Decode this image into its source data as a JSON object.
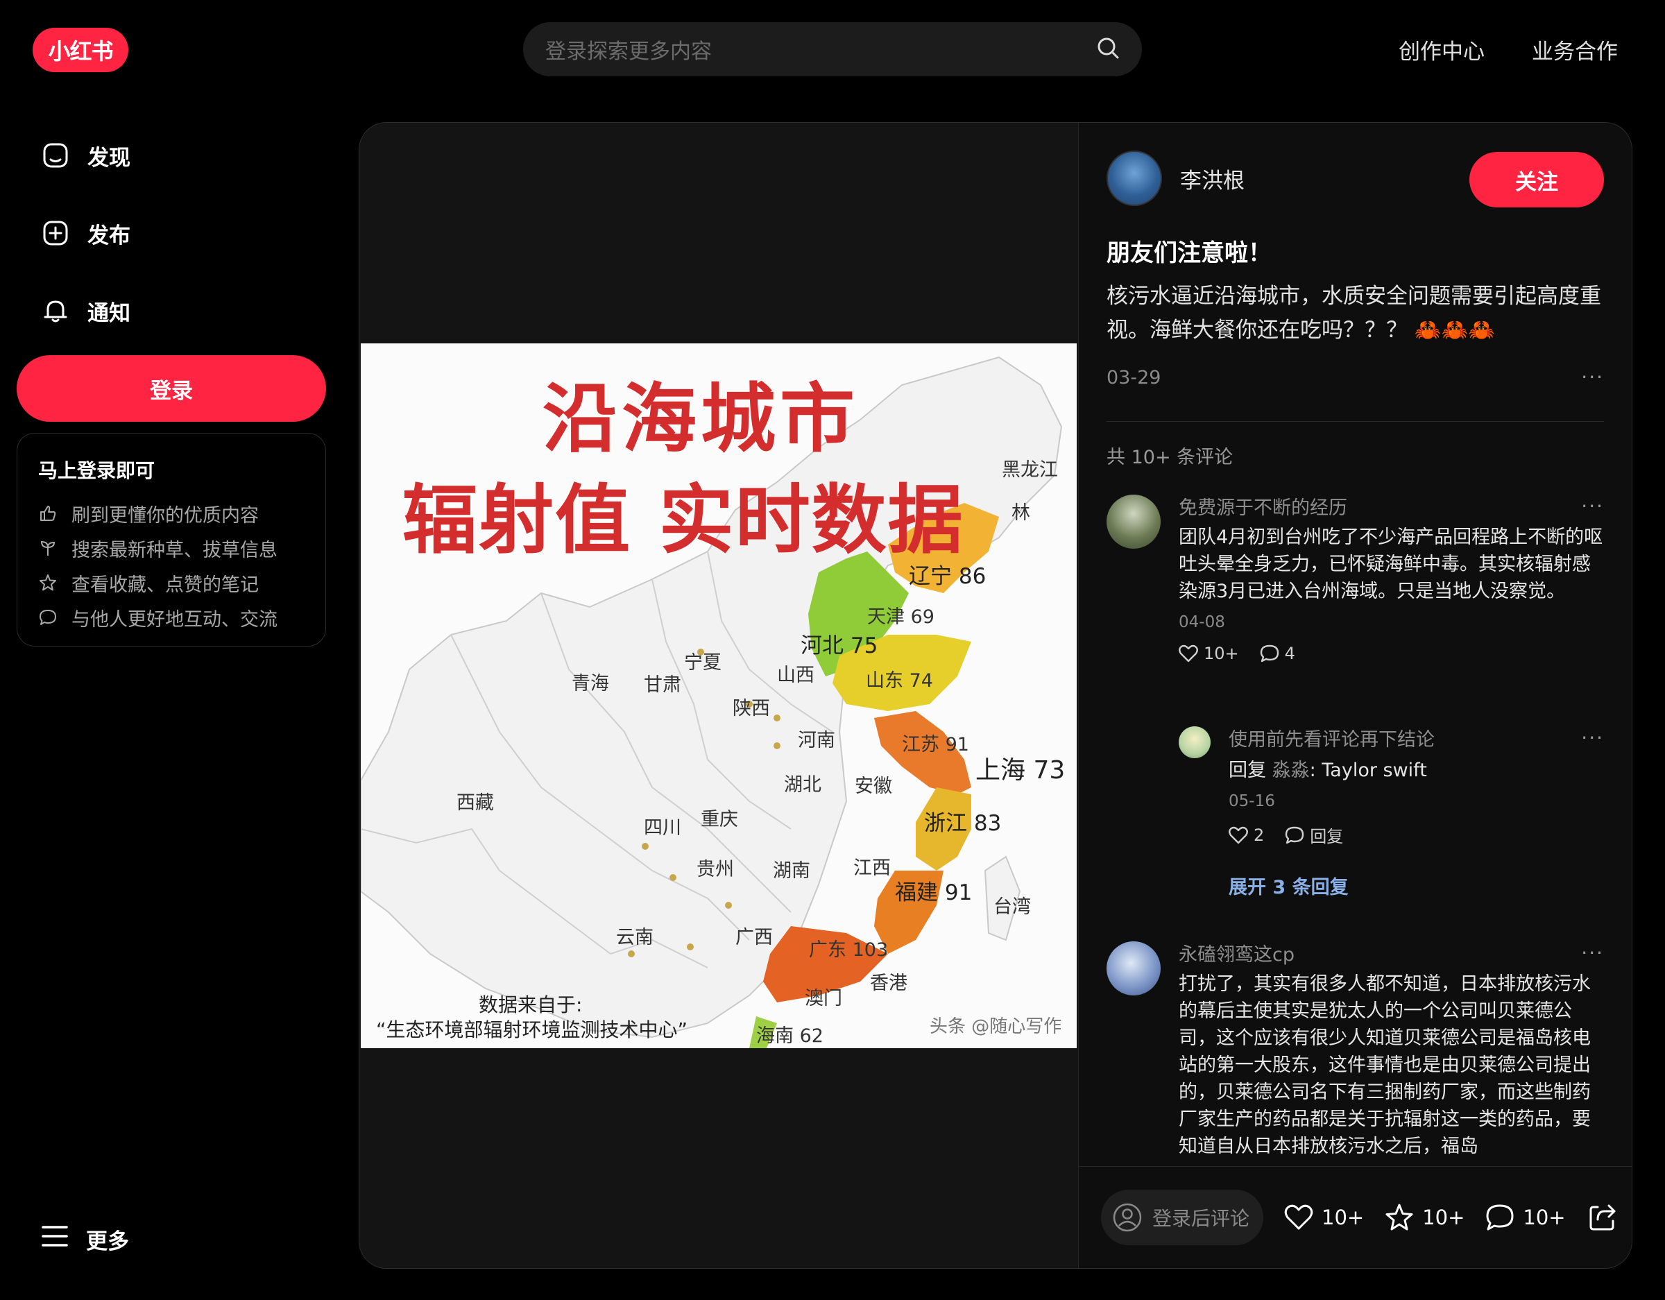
{
  "header": {
    "logo": "小红书",
    "search_placeholder": "登录探索更多内容",
    "nav": [
      "创作中心",
      "业务合作"
    ]
  },
  "sidebar": {
    "items": [
      {
        "label": "发现",
        "icon": "home-icon"
      },
      {
        "label": "发布",
        "icon": "plus-square-icon"
      },
      {
        "label": "通知",
        "icon": "bell-icon"
      }
    ],
    "login_label": "登录",
    "promo": {
      "title": "马上登录即可",
      "items": [
        {
          "label": "刷到更懂你的优质内容",
          "icon": "thumbs-up-icon"
        },
        {
          "label": "搜索最新种草、拔草信息",
          "icon": "sprout-icon"
        },
        {
          "label": "查看收藏、点赞的笔记",
          "icon": "star-icon"
        },
        {
          "label": "与他人更好地互动、交流",
          "icon": "chat-icon"
        }
      ]
    },
    "more_label": "更多"
  },
  "map": {
    "title_line1": "沿海城市",
    "title_line2": "辐射值 实时数据",
    "source_line1": "数据来自于:",
    "source_line2": "“生态环境部辐射环境监测技术中心”",
    "watermark": "头条 @随心写作",
    "labels": {
      "heilongjiang": "黑龙江",
      "jilin": "林",
      "liaoning": "辽宁 86",
      "tianjin": "天津 69",
      "hebei": "河北 75",
      "ningxia": "宁夏",
      "shanxi": "山西",
      "shandong": "山东 74",
      "qinghai": "青海",
      "gansu": "甘肃",
      "shaanxi": "陕西",
      "henan": "河南",
      "jiangsu": "江苏 91",
      "shanghai": "上海 73",
      "hubei": "湖北",
      "anhui": "安徽",
      "xizang": "西藏",
      "sichuan": "四川",
      "chongqing": "重庆",
      "zhejiang": "浙江 83",
      "guizhou": "贵州",
      "hunan": "湖南",
      "jiangxi": "江西",
      "fujian": "福建 91",
      "taiwan": "台湾",
      "yunnan": "云南",
      "guangxi": "广西",
      "guangdong": "广东 103",
      "hongkong": "香港",
      "macau": "澳门",
      "hainan": "海南 62"
    }
  },
  "note": {
    "author": "李洪根",
    "follow_label": "关注",
    "title": "朋友们注意啦！",
    "desc": "核污水逼近沿海城市，水质安全问题需要引起高度重视。海鲜大餐你还在吃吗？？？ 🦀🦀🦀",
    "date": "03-29",
    "comment_count": "共 10+ 条评论"
  },
  "comments": [
    {
      "name": "免费源于不断的经历",
      "text": "团队4月初到台州吃了不少海产品回程路上不断的呕吐头晕全身乏力，已怀疑海鲜中毒。其实核辐射感染源3月已进入台州海域。只是当地人没察觉。",
      "date": "04-08",
      "likes": "10+",
      "replies": "4"
    },
    {
      "name": "使用前先看评论再下结论",
      "reply_prefix": "回复",
      "reply_to": "淼淼",
      "text": ": Taylor swift",
      "date": "05-16",
      "likes": "2",
      "reply_label": "回复"
    },
    {
      "expand_label": "展开 3 条回复"
    },
    {
      "name": "永磕翎鸾这cp",
      "text": "打扰了，其实有很多人都不知道，日本排放核污水的幕后主使其实是犹太人的一个公司叫贝莱德公司，这个应该有很少人知道贝莱德公司是福岛核电站的第一大股东，这件事情也是由贝莱德公司提出的，贝莱德公司名下有三捆制药厂家，而这些制药厂家生产的药品都是关于抗辐射这一类的药品，要知道自从日本排放核污水之后，福岛"
    }
  ],
  "bottom": {
    "input_placeholder": "登录后评论",
    "likes": "10+",
    "collects": "10+",
    "comments": "10+"
  },
  "colors": {
    "brand": "#ff2442",
    "background": "#000000",
    "panel": "#0e0e0e"
  }
}
